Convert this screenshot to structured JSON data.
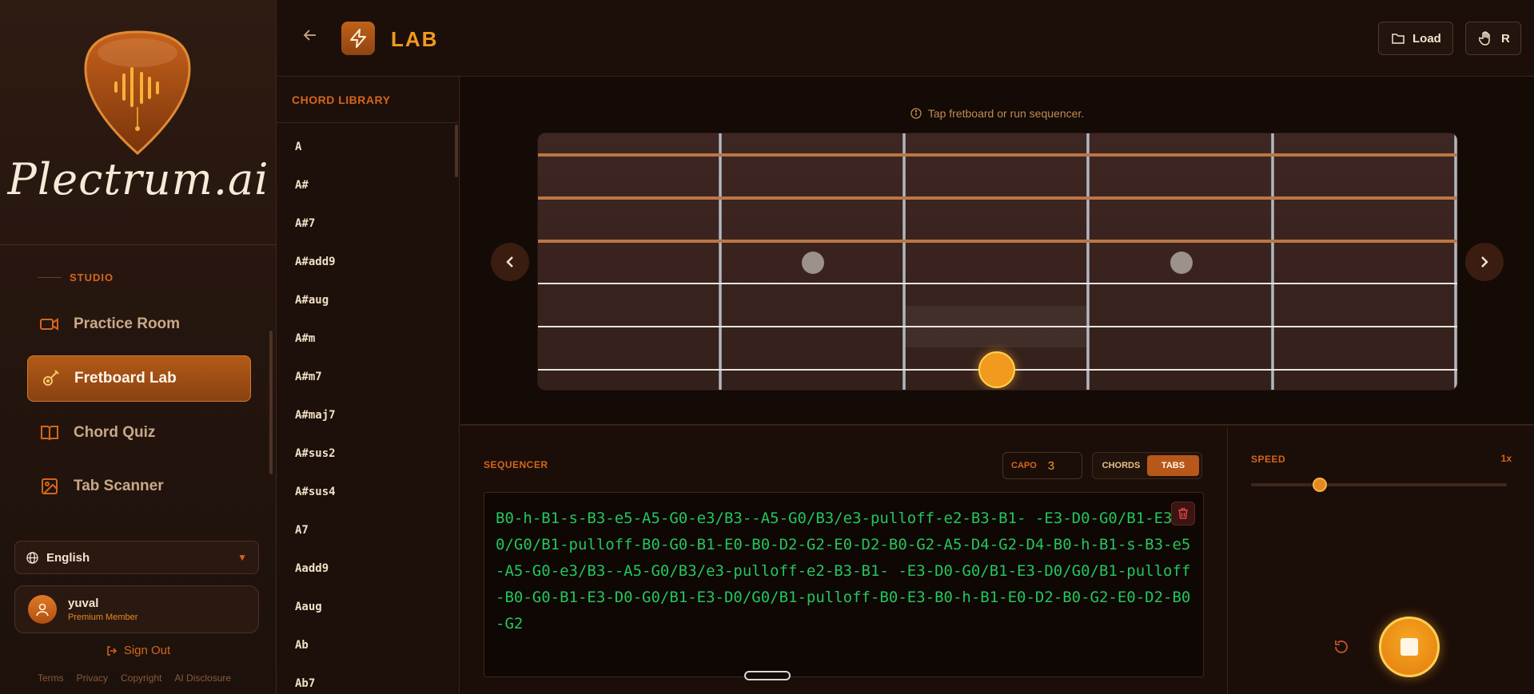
{
  "app": {
    "brand": "Plectrum.ai",
    "page_title": "LAB"
  },
  "sidebar": {
    "section_label": "STUDIO",
    "items": [
      {
        "label": "Practice Room",
        "icon": "video-icon",
        "active": false
      },
      {
        "label": "Fretboard Lab",
        "icon": "guitar-icon",
        "active": true
      },
      {
        "label": "Chord Quiz",
        "icon": "book-icon",
        "active": false
      },
      {
        "label": "Tab Scanner",
        "icon": "image-icon",
        "active": false
      }
    ],
    "language": "English",
    "user": {
      "name": "yuval",
      "tier": "Premium Member"
    },
    "sign_out": "Sign Out",
    "footer": [
      "Terms",
      "Privacy",
      "Copyright",
      "AI Disclosure"
    ]
  },
  "header": {
    "load_label": "Load",
    "right_label": "R"
  },
  "library": {
    "title": "CHORD LIBRARY",
    "chords": [
      "A",
      "A#",
      "A#7",
      "A#add9",
      "A#aug",
      "A#m",
      "A#m7",
      "A#maj7",
      "A#sus2",
      "A#sus4",
      "A7",
      "Aadd9",
      "Aaug",
      "Ab",
      "Ab7"
    ]
  },
  "fretboard": {
    "hint": "Tap fretboard or run sequencer."
  },
  "sequencer": {
    "label": "SEQUENCER",
    "capo_label": "CAPO",
    "capo_value": "3",
    "modes": [
      "CHORDS",
      "TABS"
    ],
    "active_mode": "TABS",
    "tab_text": "B0-h-B1-s-B3-e5-A5-G0-e3/B3--A5-G0/B3/e3-pulloff-e2-B3-B1- -E3-D0-G0/B1-E3-D0/G0/B1-pulloff-B0-G0-B1-E0-B0-D2-G2-E0-D2-B0-G2-A5-D4-G2-D4-B0-h-B1-s-B3-e5-A5-G0-e3/B3--A5-G0/B3/e3-pulloff-e2-B3-B1- -E3-D0-G0/B1-E3-D0/G0/B1-pulloff-B0-G0-B1-E3-D0-G0/B1-E3-D0/G0/B1-pulloff-B0-E3-B0-h-B1-E0-D2-B0-G2-E0-D2-B0-G2"
  },
  "speed": {
    "label": "SPEED",
    "value_label": "1x",
    "level": 0.27
  },
  "colors": {
    "accent": "#d4661c",
    "active_note": "#f29a1e",
    "tab_green": "#22c55e"
  }
}
